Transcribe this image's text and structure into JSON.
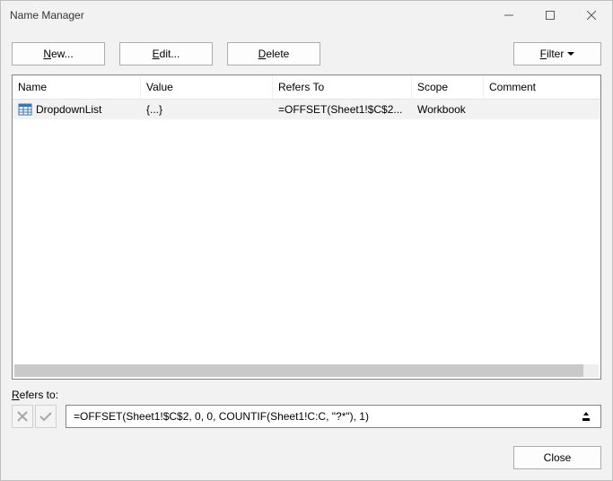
{
  "window": {
    "title": "Name Manager"
  },
  "toolbar": {
    "new_label": "New...",
    "edit_label": "Edit...",
    "delete_label": "Delete",
    "filter_label": "Filter"
  },
  "columns": {
    "name": "Name",
    "value": "Value",
    "refers": "Refers To",
    "scope": "Scope",
    "comment": "Comment"
  },
  "rows": [
    {
      "icon": "table-icon",
      "name": "DropdownList",
      "value": "{...}",
      "refers": "=OFFSET(Sheet1!$C$2...",
      "scope": "Workbook",
      "comment": ""
    }
  ],
  "refers_to": {
    "label": "Refers to:",
    "value": "=OFFSET(Sheet1!$C$2, 0, 0, COUNTIF(Sheet1!C:C, \"?*\"), 1)"
  },
  "footer": {
    "close_label": "Close"
  }
}
